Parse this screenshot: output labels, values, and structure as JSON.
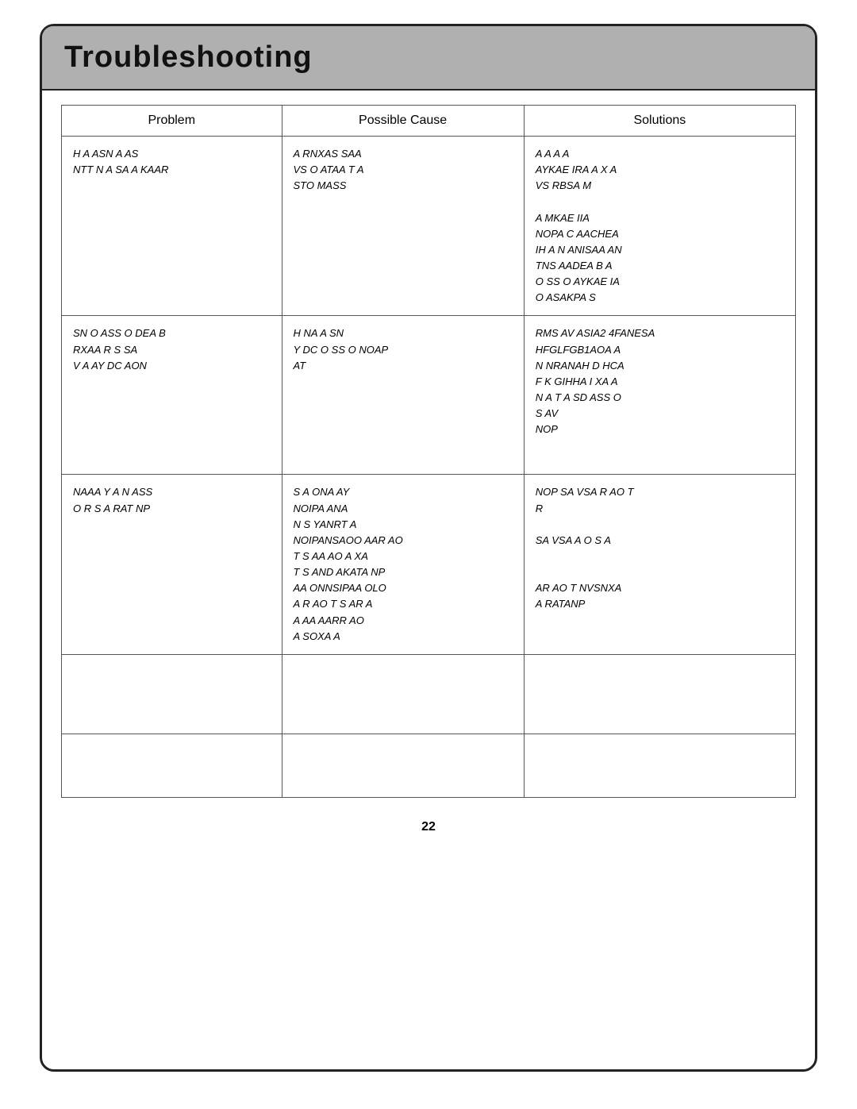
{
  "title": "Troubleshooting",
  "table": {
    "headers": [
      "Problem",
      "Possible Cause",
      "Solutions"
    ],
    "rows": [
      {
        "problem": "H A      ASN   A  AS\nNTT  N  A  SA    A  KAAR",
        "cause": "A       RNXAS  SAA\nVS   O   ATAA T   A\nSTO   MASS",
        "solution": "A       A A         A\nAYKAE  IRA   A X  A\n         VS  RBSA  M\n\nA       MKAE  IIA\nNOPA   C   AACHEA\nIH  A  N   ANISAA  AN\nTNS   AADEA   B  A\nO  SS O    AYKAE  IA\nO       ASAKPA  S"
      },
      {
        "problem": "SN     O ASS  O  DEA    B\nRXAA       R  S    SA\nV     A      AY  DC  AON",
        "cause": "H  NA  A         SN\nY   DC   O  SS  O    NOAP\n           AT",
        "solution": "RMS AV     ASIA2 4FANESA\nHFGLFGB1AOA    A\nN    NRANAH  D   HCA\nF K   GIHHA  I  XA  A\nN    A  T  A    SD  ASS O\n                      S  AV\nNOP"
      },
      {
        "problem": "NAAA  Y   A  N  ASS\nO  R   S  A    RAT  NP",
        "cause": "S    A   ONA   AY\n       NOIPA    ANA\nN    S    YANRT     A\nNOIPANSAOO    AAR AO\nT    S  AA    AO A       XA\nT    S    AND   AKATA  NP\nAA        ONNSIPAA    OLO\nA R AO    T    S  AR  A\nA     AA     AARR AO\nA     SOXA  A",
        "solution": "NOP   SA   VSA  R AO    T\n           R\n\nSA  VSA   A  O  S  A\n\n\nAR AO    T  NVSNXA\nA   RATANP"
      },
      {
        "problem": "",
        "cause": "",
        "solution": ""
      },
      {
        "problem": "",
        "cause": "",
        "solution": ""
      }
    ]
  },
  "page_number": "22"
}
